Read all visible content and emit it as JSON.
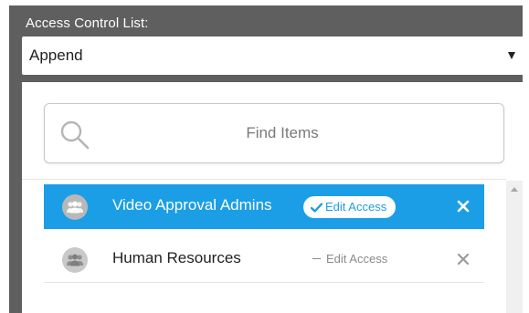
{
  "acl": {
    "label": "Access Control List:",
    "mode": {
      "selected": "Append"
    }
  },
  "search": {
    "placeholder": "Find Items",
    "value": ""
  },
  "items": [
    {
      "name": "Video Approval Admins",
      "edit_access_label": "Edit Access",
      "edit_access_checked": true,
      "selected": true,
      "icon": "group-icon",
      "remove_icon": "close-icon"
    },
    {
      "name": "Human Resources",
      "edit_access_label": "Edit Access",
      "edit_access_checked": false,
      "selected": false,
      "icon": "group-icon",
      "remove_icon": "close-icon"
    }
  ],
  "colors": {
    "panel_bg": "#5f5f5f",
    "accent": "#1b9ee5",
    "muted_text": "#8a8a8a"
  }
}
